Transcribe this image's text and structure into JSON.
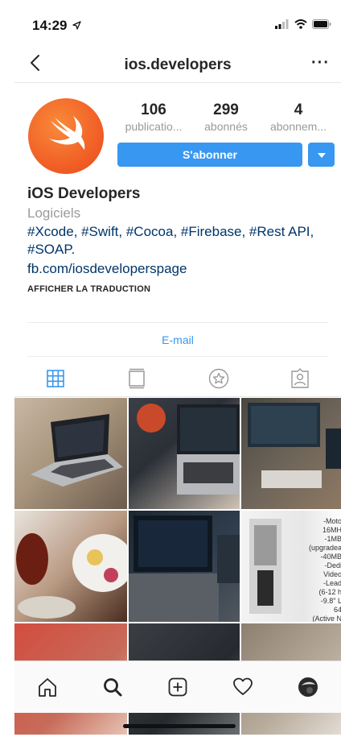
{
  "status": {
    "time": "14:29"
  },
  "nav": {
    "title": "ios.developers",
    "more": "···"
  },
  "stats": [
    {
      "value": "106",
      "label": "publicatio..."
    },
    {
      "value": "299",
      "label": "abonnés"
    },
    {
      "value": "4",
      "label": "abonnem..."
    }
  ],
  "actions": {
    "follow": "S'abonner"
  },
  "bio": {
    "name": "iOS Developers",
    "category": "Logiciels",
    "hashtags": "#Xcode, #Swift, #Cocoa, #Firebase, #Rest API, #SOAP.",
    "link": "fb.com/iosdeveloperspage",
    "translate": "AFFICHER LA TRADUCTION"
  },
  "contact": {
    "email": "E-mail"
  },
  "tabs": [
    "grid-icon",
    "feed-icon",
    "saved-star-icon",
    "tagged-icon"
  ],
  "grid": {
    "spec_text": "-Moto\n16MH\n-1MB\n(upgradea\n-40MB\n-Dedi\nVideo\n-Lead\n(6-12 h\n-9.8\" L\n64\n(Active N"
  },
  "bottom_nav": [
    "home-icon",
    "search-icon",
    "add-post-icon",
    "heart-icon",
    "profile-avatar"
  ],
  "colors": {
    "accent": "#3897f0",
    "link": "#003569",
    "avatar": "#f05a23"
  }
}
